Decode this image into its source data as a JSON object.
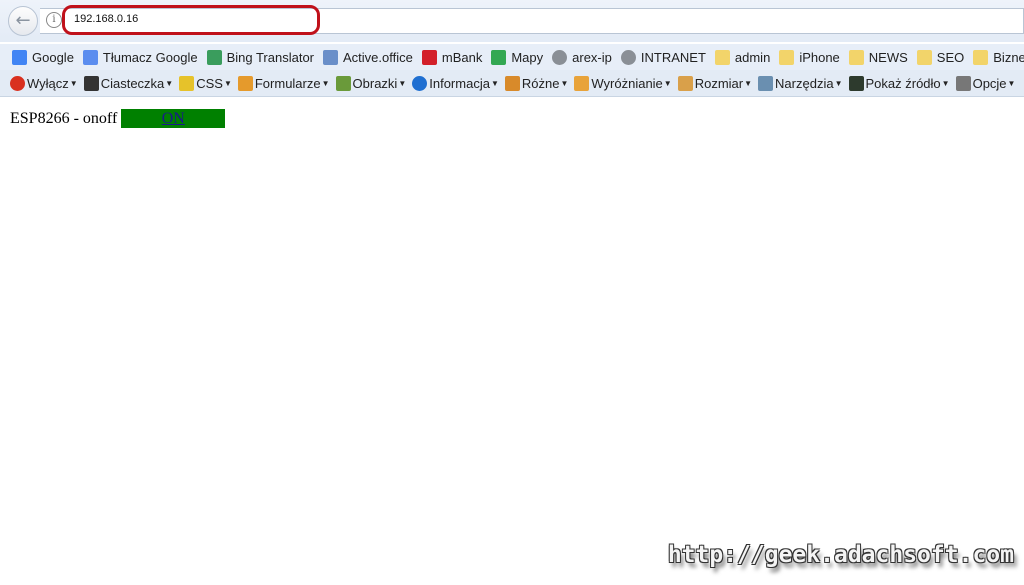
{
  "browser": {
    "back_icon": "arrow-left-icon",
    "info_icon": "info-icon",
    "url": "192.168.0.16",
    "highlight_color": "#c0111a"
  },
  "bookmarks": [
    {
      "label": "Google",
      "icon": "google-icon",
      "color": "#4285f4"
    },
    {
      "label": "Tłumacz Google",
      "icon": "translate-icon",
      "color": "#5b8def"
    },
    {
      "label": "Bing Translator",
      "icon": "bing-translator-icon",
      "color": "#3a9d5d"
    },
    {
      "label": "Active.office",
      "icon": "active-office-icon",
      "color": "#6a8fc9"
    },
    {
      "label": "mBank",
      "icon": "mbank-icon",
      "color": "#d3202a"
    },
    {
      "label": "Mapy",
      "icon": "maps-icon",
      "color": "#34a853"
    },
    {
      "label": "arex-ip",
      "icon": "globe-icon",
      "color": "#8a8f96"
    },
    {
      "label": "INTRANET",
      "icon": "globe-icon",
      "color": "#8a8f96"
    },
    {
      "label": "admin",
      "icon": "folder-icon",
      "color": "#f2d46a"
    },
    {
      "label": "iPhone",
      "icon": "folder-icon",
      "color": "#f2d46a"
    },
    {
      "label": "NEWS",
      "icon": "folder-icon",
      "color": "#f2d46a"
    },
    {
      "label": "SEO",
      "icon": "folder-icon",
      "color": "#f2d46a"
    },
    {
      "label": "Biznes",
      "icon": "folder-icon",
      "color": "#f2d46a"
    }
  ],
  "toolbar": [
    {
      "label": "Wyłącz",
      "icon": "disable-icon",
      "color": "#d9301f"
    },
    {
      "label": "Ciasteczka",
      "icon": "cookie-user-icon",
      "color": "#333333"
    },
    {
      "label": "CSS",
      "icon": "wand-icon",
      "color": "#e6c22a"
    },
    {
      "label": "Formularze",
      "icon": "clipboard-icon",
      "color": "#e59a2c"
    },
    {
      "label": "Obrazki",
      "icon": "image-icon",
      "color": "#6a9a3a"
    },
    {
      "label": "Informacja",
      "icon": "info-icon",
      "color": "#1f6fd1"
    },
    {
      "label": "Różne",
      "icon": "book-icon",
      "color": "#d88a2a"
    },
    {
      "label": "Wyróżnianie",
      "icon": "pencil-icon",
      "color": "#e8a33a"
    },
    {
      "label": "Rozmiar",
      "icon": "ruler-icon",
      "color": "#d9a04a"
    },
    {
      "label": "Narzędzia",
      "icon": "tools-icon",
      "color": "#6a8fb0"
    },
    {
      "label": "Pokaż źródło",
      "icon": "terminal-icon",
      "color": "#2d3a2d"
    },
    {
      "label": "Opcje",
      "icon": "options-icon",
      "color": "#777777"
    }
  ],
  "page": {
    "text": "ESP8266 - onoff",
    "button_label": "ON",
    "button_color": "#008000"
  },
  "watermark": "http://geek.adachsoft.com"
}
